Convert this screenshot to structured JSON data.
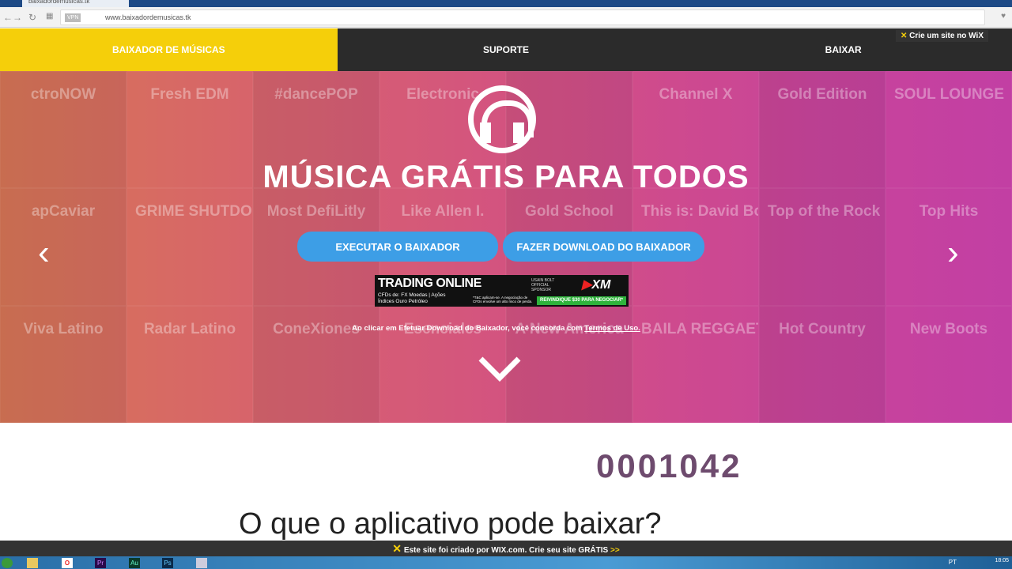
{
  "browser": {
    "tab_title": "baixadordemusicas.tk",
    "url": "www.baixadordemusicas.tk",
    "vpn": "VPN"
  },
  "nav": {
    "items": [
      {
        "label": "BAIXADOR DE MÚSICAS"
      },
      {
        "label": "SUPORTE"
      },
      {
        "label": "BAIXAR"
      }
    ],
    "wix_badge": "Crie um site no WiX"
  },
  "hero": {
    "tiles": [
      "ctroNOW",
      "Fresh EDM",
      "#dancePOP",
      "Electronic",
      "",
      "Channel X",
      "Gold Edition",
      "SOUL LOUNGE",
      "apCaviar",
      "GRIME SHUTDOWN",
      "Most DefiLitly",
      "Like Allen I.",
      "Gold School",
      "This is: David Bowie",
      "Top of the Rock",
      "Top Hits",
      "Viva Latino",
      "Radar Latino",
      "ConeXiones",
      "Esenciales",
      "A New America",
      "BAILA REGGAETON",
      "Hot Country",
      "New Boots"
    ],
    "title": "MÚSICA GRÁTIS PARA TODOS",
    "run_button": "EXECUTAR O BAIXADOR",
    "download_button": "FAZER DOWNLOAD DO BAIXADOR",
    "terms_text": "Ao clicar em Efetuar Download do Baixador, você concorda com ",
    "terms_link": "Termos de Uso."
  },
  "ad": {
    "title": "TRADING ONLINE",
    "line1": "CFDs de: FX Moedas | Ações",
    "line2": "Índices  Ouro  Petróleo",
    "disclaimer": "*T&C aplicam-se. A negociação de CFDs envolve um alto risco de perda.",
    "sponsor": "USAIN BOLT OFFICIAL SPONSOR",
    "brand": "XM",
    "cta": "REIVINDIQUE $30 PARA NEGOCIAR*"
  },
  "counter": "0001042",
  "section_heading": "O que o aplicativo pode baixar?",
  "wix_footer": {
    "text": "Este site foi criado por WIX.com. Crie seu site GRÁTIS",
    "arrow": ">>"
  },
  "taskbar": {
    "apps": [
      "Pr",
      "Au",
      "Ps"
    ],
    "lang": "PT",
    "time": "18:05"
  }
}
